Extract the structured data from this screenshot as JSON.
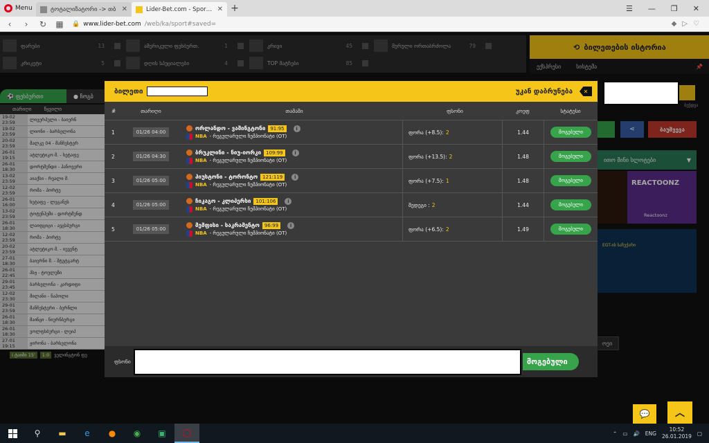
{
  "browser": {
    "menu_label": "Menu",
    "tabs": [
      {
        "title": "ტოტალიზატორი -> თბ",
        "active": false
      },
      {
        "title": "Lider-Bet.com - Sports and",
        "active": true
      }
    ],
    "new_tab": "+",
    "url_host": "www.lider-bet.com",
    "url_path": "/web/ka/sport#saved="
  },
  "sports": [
    {
      "label": "ფარები",
      "count": "13"
    },
    {
      "label": "ამერიკული ფეხბურთ.",
      "count": "1"
    },
    {
      "label": "კრივი",
      "count": "45"
    },
    {
      "label": "მურული ორთაბრძოლა",
      "count": "79"
    },
    {
      "label": "კრიკეტი",
      "count": "5"
    },
    {
      "label": "დღის სპეციალები",
      "count": "4"
    },
    {
      "label": "TOP მატჩები",
      "count": "85"
    }
  ],
  "history": {
    "button": "ბილეთების ისტორია",
    "tab1": "ექსპრესი",
    "tab2": "სისტემა"
  },
  "left_tabs": {
    "football": "ფეხბურთი",
    "basketball": "ჩოგბ"
  },
  "match_list": {
    "head_date": "თარიღი",
    "head_name": "წყვილი",
    "rows": [
      {
        "d": "19-02 23:59",
        "n": "ლივერპული - ბაიერნ"
      },
      {
        "d": "19-02 23:59",
        "n": "ლიონი - ბარსელონა"
      },
      {
        "d": "20-02 23:59",
        "n": "შალკე 04 - მანჩესტერ"
      },
      {
        "d": "26-01 19:15",
        "n": "ატლეტიკო მ. - ხეტაფე"
      },
      {
        "d": "26-01 18:30",
        "n": "დორტმუნდი - ჰანოვერი"
      },
      {
        "d": "13-02 23:59",
        "n": "აიაქსი - რეალი მ."
      },
      {
        "d": "12-02 23:59",
        "n": "რომა - პორტუ"
      },
      {
        "d": "26-01 16:00",
        "n": "ხეტაფე - ლეგანეს"
      },
      {
        "d": "13-02 23:59",
        "n": "ტოტენჰემი - დორტმუნდ"
      },
      {
        "d": "26-01 18:30",
        "n": "ლაიფციგი - ავგსბურგი"
      },
      {
        "d": "12-02 23:59",
        "n": "რომა - პორტუ"
      },
      {
        "d": "20-02 23:59",
        "n": "ატლეტიკო მ. - იუვენტ"
      },
      {
        "d": "27-01 18:30",
        "n": "ბაიერნი მ. - შტუტგარტ"
      },
      {
        "d": "26-01 22:45",
        "n": "პსჟ - ტოულუზი"
      },
      {
        "d": "29-01 23:45",
        "n": "ბარსელონა - კარდიფი"
      },
      {
        "d": "12-02 23:30",
        "n": "მილანი - ნაპოლი"
      },
      {
        "d": "29-01 23:59",
        "n": "მანჩესტერი - ბერნლი"
      },
      {
        "d": "26-01 18:30",
        "n": "მაინცი - ნიურნბერგი"
      },
      {
        "d": "26-01 18:30",
        "n": "ვოლფსბურგი - ლეიპ"
      },
      {
        "d": "27-01 19:15",
        "n": "ჟირონა - ბარსელონა"
      }
    ],
    "live_time": "I ტაიმი 15'",
    "live_score": "1:0",
    "live_name": "ველინგტონ ფე"
  },
  "right": {
    "print": "ბეჭდვა",
    "red_btn": "ბაუშვევა",
    "slots": "ითო მინი სლოტები",
    "reactoonz": "REACTOONZ",
    "reactoonz_sub": "Reactoonz",
    "promo": "EGT-ის საჩუქარი",
    "bottom_tab": "ოეი"
  },
  "modal": {
    "ticket_label": "ბილეთი",
    "back_label": "უკან დაბრუნება",
    "cols": {
      "num": "#",
      "date": "თარიღი",
      "event": "თამაში",
      "bet": "ფსონი",
      "coef": "კოეფ",
      "status": "სტატუსი"
    },
    "rows": [
      {
        "num": "1",
        "date": "01/26 04:00",
        "match": "ორლანდო - ვაშინგტონი",
        "score": "91:95",
        "league": "NBA",
        "league_sub": "- რეგულარული ჩემპიონატი (OT)",
        "bet": "ფორა (+8.5):",
        "bet_val": "2",
        "coef": "1.44",
        "status": "მოგებული"
      },
      {
        "num": "2",
        "date": "01/26 04:30",
        "match": "ბრუკლინი - ნიუ-იორკი",
        "score": "109:99",
        "league": "NBA",
        "league_sub": "- რეგულარული ჩემპიონატი (OT)",
        "bet": "ფორა (+13.5):",
        "bet_val": "2",
        "coef": "1.48",
        "status": "მოგებული"
      },
      {
        "num": "3",
        "date": "01/26 05:00",
        "match": "ჰიუსტონი - ტორონტო",
        "score": "121:119",
        "league": "NBA",
        "league_sub": "- რეგულარული ჩემპიონატი (OT)",
        "bet": "ფორა (+7.5):",
        "bet_val": "1",
        "coef": "1.48",
        "status": "მოგებული"
      },
      {
        "num": "4",
        "date": "01/26 05:00",
        "match": "ჩიკაგო - კლიპერსი",
        "score": "101:106",
        "league": "NBA",
        "league_sub": "- რეგულარული ჩემპიონატი (OT)",
        "bet": "შედეგი :",
        "bet_val": "2",
        "coef": "1.44",
        "status": "მოგებული"
      },
      {
        "num": "5",
        "date": "01/26 05:00",
        "match": "მემფისი - საკრამენტო",
        "score": "96:99",
        "league": "NBA",
        "league_sub": "- რეგულარული ჩემპიონატი (OT)",
        "bet": "ფორა (+6.5):",
        "bet_val": "2",
        "coef": "1.49",
        "status": "მოგებული"
      }
    ],
    "foot_label": "ფსონი",
    "foot_status": "მოგებული"
  },
  "taskbar": {
    "lang": "ENG",
    "time": "10:52",
    "date": "26.01.2019"
  },
  "colors": {
    "accent": "#f5c518",
    "won": "#37a34a"
  }
}
